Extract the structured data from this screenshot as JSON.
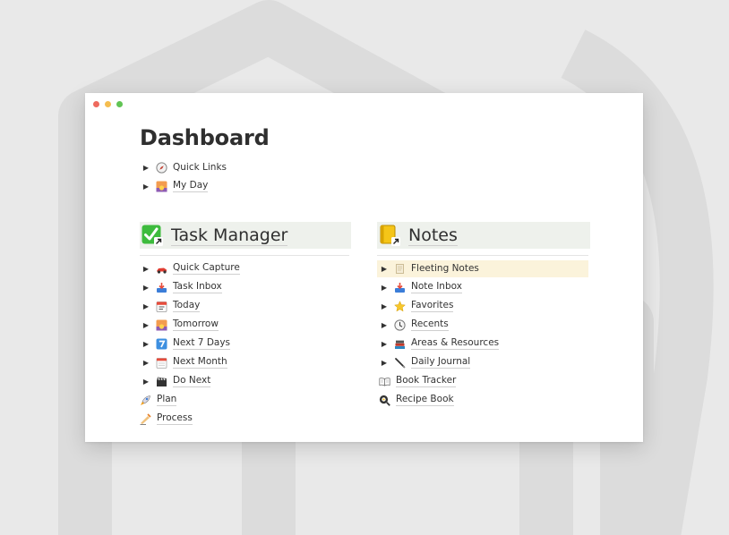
{
  "page": {
    "title": "Dashboard"
  },
  "top_links": [
    {
      "label": "Quick Links",
      "icon": "compass-icon"
    },
    {
      "label": "My Day",
      "icon": "sunrise-icon"
    }
  ],
  "task_manager": {
    "heading": "Task Manager",
    "icon": "check-box-icon",
    "items": [
      {
        "label": "Quick Capture",
        "icon": "race-car-icon",
        "expandable": true
      },
      {
        "label": "Task Inbox",
        "icon": "inbox-tray-icon",
        "expandable": true
      },
      {
        "label": "Today",
        "icon": "calendar-icon",
        "expandable": true
      },
      {
        "label": "Tomorrow",
        "icon": "sunrise-icon",
        "expandable": true
      },
      {
        "label": "Next 7 Days",
        "icon": "seven-icon",
        "expandable": true
      },
      {
        "label": "Next Month",
        "icon": "tear-off-calendar-icon",
        "expandable": true
      },
      {
        "label": "Do Next",
        "icon": "clapper-board-icon",
        "expandable": true
      },
      {
        "label": "Plan",
        "icon": "rocket-icon",
        "expandable": false
      },
      {
        "label": "Process",
        "icon": "writing-hand-icon",
        "expandable": false
      }
    ]
  },
  "notes": {
    "heading": "Notes",
    "icon": "notebook-icon",
    "items": [
      {
        "label": "Fleeting Notes",
        "icon": "scroll-icon",
        "expandable": true,
        "highlighted": true
      },
      {
        "label": "Note Inbox",
        "icon": "inbox-tray-icon",
        "expandable": true
      },
      {
        "label": "Favorites",
        "icon": "star-icon",
        "expandable": true
      },
      {
        "label": "Recents",
        "icon": "clock-icon",
        "expandable": true
      },
      {
        "label": "Areas & Resources",
        "icon": "books-icon",
        "expandable": true
      },
      {
        "label": "Daily Journal",
        "icon": "pen-icon",
        "expandable": true
      },
      {
        "label": "Book Tracker",
        "icon": "open-book-icon",
        "expandable": false
      },
      {
        "label": "Recipe Book",
        "icon": "frying-pan-icon",
        "expandable": false
      }
    ]
  },
  "colors": {
    "heading_bg": "#eef1ec",
    "highlight_bg": "#fbf3db"
  }
}
